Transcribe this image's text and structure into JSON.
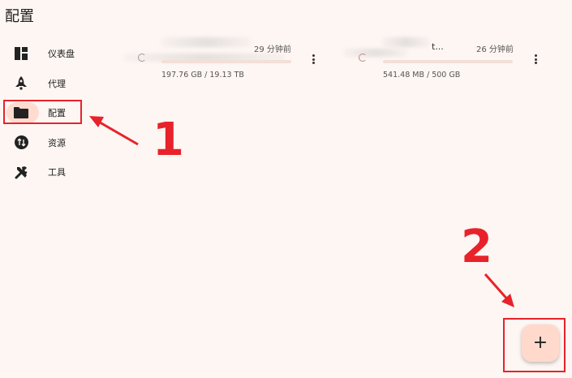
{
  "page": {
    "title": "配置"
  },
  "sidebar": {
    "items": [
      {
        "label": "仪表盘",
        "icon": "dashboard-icon"
      },
      {
        "label": "代理",
        "icon": "rocket-icon"
      },
      {
        "label": "配置",
        "icon": "folder-icon",
        "active": true
      },
      {
        "label": "资源",
        "icon": "sync-resources-icon"
      },
      {
        "label": "工具",
        "icon": "tools-icon"
      }
    ]
  },
  "profiles": [
    {
      "name_suffix": "",
      "updated": "29 分钟前",
      "usage": "197.76 GB / 19.13 TB",
      "progress": 0.01
    },
    {
      "name_suffix": "t...",
      "updated": "26 分钟前",
      "usage": "541.48 MB / 500 GB",
      "progress": 0.001
    }
  ],
  "fab": {
    "label": "+"
  },
  "annotations": {
    "one": "1",
    "two": "2"
  },
  "colors": {
    "accent": "#ffdccf",
    "annotation": "#e8222a",
    "background": "#fdf6f3"
  }
}
